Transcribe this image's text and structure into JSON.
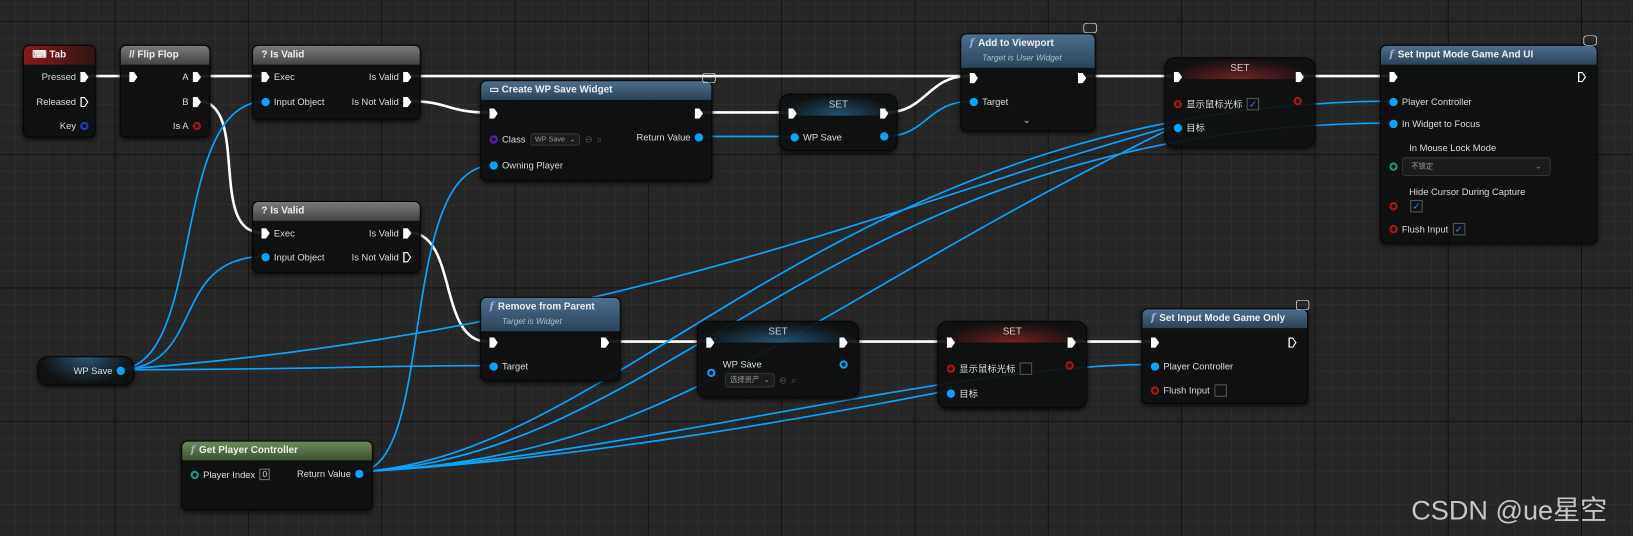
{
  "nodes": {
    "tab": {
      "title": "Tab",
      "pins": {
        "pressed": "Pressed",
        "released": "Released",
        "key": "Key"
      }
    },
    "flipflop": {
      "title": "Flip Flop",
      "pins": {
        "a": "A",
        "b": "B",
        "isa": "Is A"
      }
    },
    "isvalid1": {
      "title": "Is Valid",
      "pins": {
        "exec": "Exec",
        "input": "Input Object",
        "valid": "Is Valid",
        "notvalid": "Is Not Valid"
      }
    },
    "isvalid2": {
      "title": "Is Valid",
      "pins": {
        "exec": "Exec",
        "input": "Input Object",
        "valid": "Is Valid",
        "notvalid": "Is Not Valid"
      }
    },
    "create": {
      "title": "Create WP Save Widget",
      "pins": {
        "class": "Class",
        "class_value": "WP Save",
        "owning": "Owning Player",
        "ret": "Return Value"
      }
    },
    "set1": {
      "title": "SET",
      "pins": {
        "var": "WP Save"
      }
    },
    "addvp": {
      "title": "Add to Viewport",
      "subtitle": "Target is User Widget",
      "pins": {
        "target": "Target"
      }
    },
    "setcursor1": {
      "title": "SET",
      "pins": {
        "var": "显示鼠标光标",
        "var_checked": true,
        "target": "目标"
      }
    },
    "gameui": {
      "title": "Set Input Mode Game And UI",
      "pins": {
        "pc": "Player Controller",
        "focus": "In Widget to Focus",
        "lock": "In Mouse Lock Mode",
        "lock_value": "不锁定",
        "hide": "Hide Cursor During Capture",
        "hide_checked": true,
        "flush": "Flush Input",
        "flush_checked": true
      }
    },
    "wpsave": {
      "title": "WP Save"
    },
    "remove": {
      "title": "Remove from Parent",
      "subtitle": "Target is Widget",
      "pins": {
        "target": "Target"
      }
    },
    "set2": {
      "title": "SET",
      "pins": {
        "var": "WP Save",
        "asset_value": "选择资产"
      }
    },
    "setcursor2": {
      "title": "SET",
      "pins": {
        "var": "显示鼠标光标",
        "var_checked": false,
        "target": "目标"
      }
    },
    "gameonly": {
      "title": "Set Input Mode Game Only",
      "pins": {
        "pc": "Player Controller",
        "flush": "Flush Input",
        "flush_checked": false
      }
    },
    "getpc": {
      "title": "Get Player Controller",
      "pins": {
        "index": "Player Index",
        "index_value": "0",
        "ret": "Return Value"
      }
    }
  },
  "icons": {
    "tab": "keyboard-icon",
    "flipflop": "flipflop-icon",
    "isvalid": "question-icon",
    "function": "function-icon",
    "widget": "widget-icon",
    "client": "monitor-icon"
  },
  "colors": {
    "exec": "#ffffff",
    "object": "#0aa4ff",
    "bool": "#b01414",
    "class": "#5a1ec8",
    "byte": "#1a9a80"
  },
  "watermark": "CSDN @ue星空"
}
